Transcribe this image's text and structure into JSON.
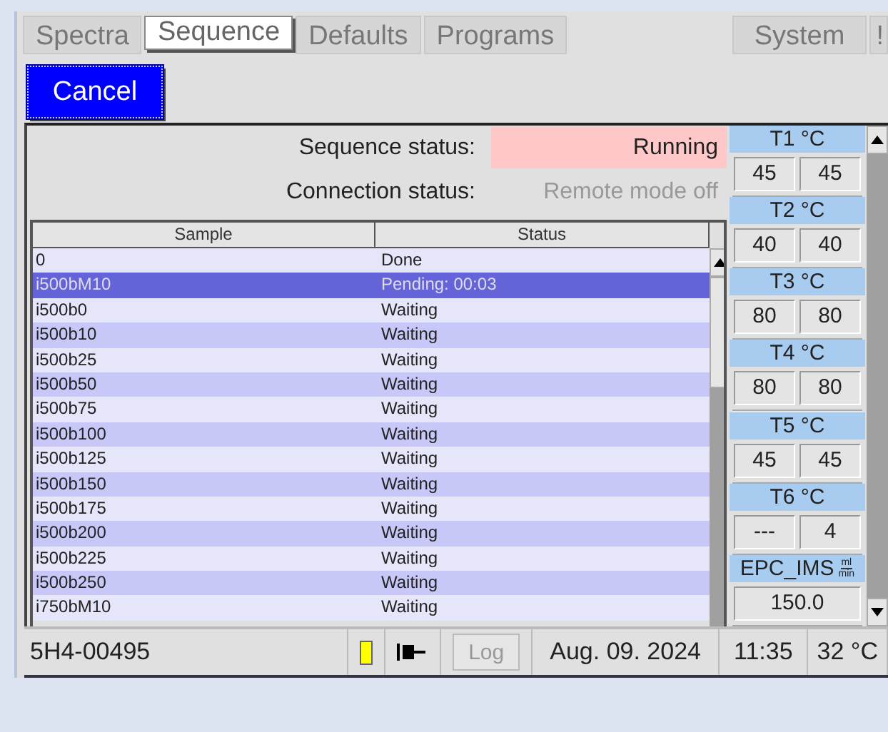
{
  "tabs": {
    "left": [
      {
        "label": "Spectra",
        "selected": false
      },
      {
        "label": "Sequence",
        "selected": true
      },
      {
        "label": "Defaults",
        "selected": false
      },
      {
        "label": "Programs",
        "selected": false
      }
    ],
    "right": [
      {
        "label": "System",
        "selected": false
      },
      {
        "label": "!",
        "selected": false
      }
    ]
  },
  "cancel_button": "Cancel",
  "status_fields": [
    {
      "label": "Sequence status:",
      "value": "Running",
      "kind": "highlight"
    },
    {
      "label": "Connection status:",
      "value": "Remote mode off",
      "kind": "muted"
    }
  ],
  "table": {
    "columns": [
      "Sample",
      "Status"
    ],
    "rows": [
      {
        "sample": "0",
        "status": "Done",
        "selected": false
      },
      {
        "sample": "i500bM10",
        "status": "Pending: 00:03",
        "selected": true
      },
      {
        "sample": "i500b0",
        "status": "Waiting",
        "selected": false
      },
      {
        "sample": "i500b10",
        "status": "Waiting",
        "selected": false
      },
      {
        "sample": "i500b25",
        "status": "Waiting",
        "selected": false
      },
      {
        "sample": "i500b50",
        "status": "Waiting",
        "selected": false
      },
      {
        "sample": "i500b75",
        "status": "Waiting",
        "selected": false
      },
      {
        "sample": "i500b100",
        "status": "Waiting",
        "selected": false
      },
      {
        "sample": "i500b125",
        "status": "Waiting",
        "selected": false
      },
      {
        "sample": "i500b150",
        "status": "Waiting",
        "selected": false
      },
      {
        "sample": "i500b175",
        "status": "Waiting",
        "selected": false
      },
      {
        "sample": "i500b200",
        "status": "Waiting",
        "selected": false
      },
      {
        "sample": "i500b225",
        "status": "Waiting",
        "selected": false
      },
      {
        "sample": "i500b250",
        "status": "Waiting",
        "selected": false
      },
      {
        "sample": "i750bM10",
        "status": "Waiting",
        "selected": false
      }
    ]
  },
  "sensors": [
    {
      "label": "T1 °C",
      "set": "45",
      "actual": "45"
    },
    {
      "label": "T2 °C",
      "set": "40",
      "actual": "40"
    },
    {
      "label": "T3 °C",
      "set": "80",
      "actual": "80"
    },
    {
      "label": "T4 °C",
      "set": "80",
      "actual": "80"
    },
    {
      "label": "T5 °C",
      "set": "45",
      "actual": "45"
    },
    {
      "label": "T6 °C",
      "set": "---",
      "actual": "4"
    },
    {
      "label": "EPC_IMS",
      "unit_top": "ml",
      "unit_bottom": "min",
      "value": "150.0"
    }
  ],
  "status_bar": {
    "device": "5H4-00495",
    "log_button": {
      "label": "Log",
      "disabled": true
    },
    "date": "Aug. 09. 2024",
    "time": "11:35",
    "temperature": "32 °C"
  }
}
